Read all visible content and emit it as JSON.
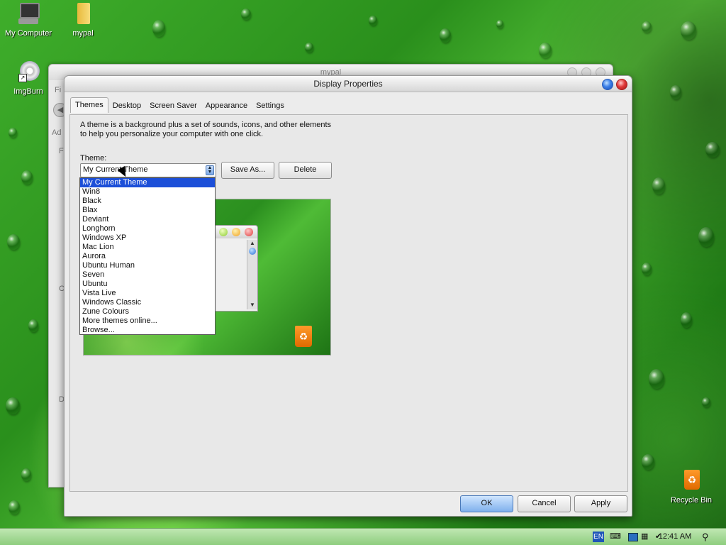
{
  "desktop": {
    "icons": [
      {
        "label": "My Computer"
      },
      {
        "label": "mypal"
      },
      {
        "label": "ImgBurn"
      },
      {
        "label": "Recycle Bin"
      }
    ]
  },
  "background_window": {
    "title": "mypal",
    "side_letters": [
      "Fi",
      "Ad",
      "F",
      "C",
      "D"
    ]
  },
  "dialog": {
    "title": "Display Properties",
    "tabs": [
      "Themes",
      "Desktop",
      "Screen Saver",
      "Appearance",
      "Settings"
    ],
    "active_tab": "Themes",
    "description": "A theme is a background plus a set of sounds, icons, and other elements to help you personalize your computer with one click.",
    "theme_label": "Theme:",
    "theme_value": "My Current Theme",
    "save_as_label": "Save As...",
    "delete_label": "Delete",
    "theme_options": [
      "My Current Theme",
      "Win8",
      "Black",
      "Blax",
      "Deviant",
      "Longhorn",
      "Windows XP",
      "Mac Lion",
      "Aurora",
      "Ubuntu Human",
      "Seven",
      "Ubuntu",
      "Vista Live",
      "Windows Classic",
      "Zune Colours",
      "More themes online...",
      "Browse..."
    ],
    "selected_option_index": 0,
    "ok_label": "OK",
    "cancel_label": "Cancel",
    "apply_label": "Apply"
  },
  "taskbar": {
    "language": "EN",
    "clock": "12:41 AM"
  },
  "colors": {
    "selection": "#1c4fd8",
    "wallpaper_green": "#3fae2b",
    "taskbar": "#a6dd97"
  }
}
